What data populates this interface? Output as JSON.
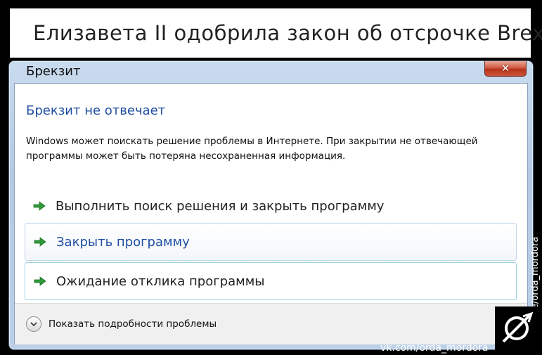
{
  "meme": {
    "title": "Елизавета II одобрила закон об отсрочке Brexit"
  },
  "dialog": {
    "window_title": "Брекзит",
    "close_icon": "close-icon",
    "heading": "Брекзит не отвечает",
    "message": "Windows может поискать решение проблемы в Интернете. При закрытии не отвечающей программы может быть потеряна несохраненная информация.",
    "options": [
      {
        "label": "Выполнить поиск решения и закрыть программу",
        "icon": "arrow-right-icon"
      },
      {
        "label": "Закрыть программу",
        "icon": "arrow-right-icon"
      },
      {
        "label": "Ожидание отклика программы",
        "icon": "arrow-right-icon"
      }
    ],
    "details_label": "Показать подробности проблемы",
    "details_icon": "chevron-down-icon"
  },
  "watermarks": {
    "side": "t.me/orda_mordora",
    "bottom": "vk.com/orda_mordora"
  },
  "colors": {
    "heading_blue": "#1f4ea3",
    "arrow_green": "#2e9a3a",
    "close_red": "#c9412a"
  }
}
